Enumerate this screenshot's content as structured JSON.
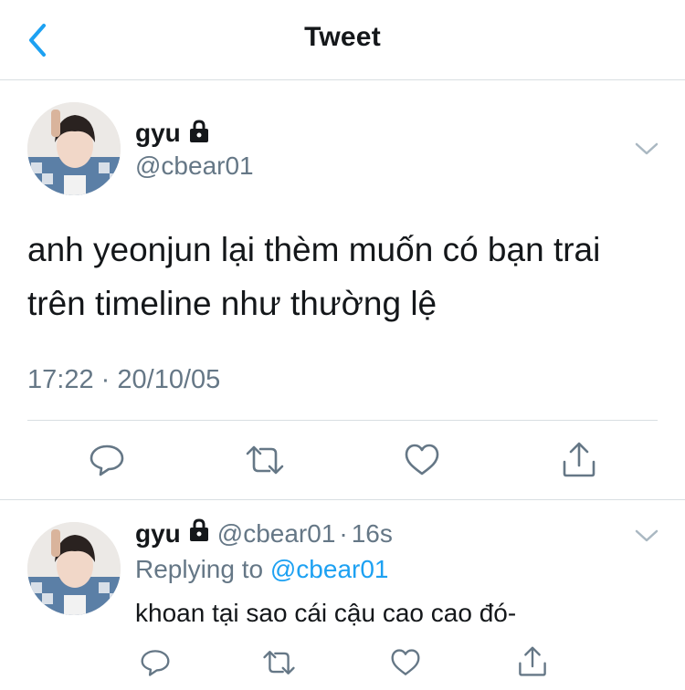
{
  "header": {
    "title": "Tweet",
    "back_icon": "chevron-left-icon",
    "accent_color": "#1da1f2"
  },
  "main_tweet": {
    "display_name": "gyu",
    "handle": "@cbear01",
    "protected_icon": "lock-icon",
    "text_line_1": "anh yeonjun lại thèm muốn có bạn trai",
    "text_line_2": "trên timeline như thường lệ",
    "time": "17:22",
    "separator": "·",
    "date": "20/10/05",
    "actions": [
      "reply-icon",
      "retweet-icon",
      "like-icon",
      "share-icon"
    ]
  },
  "reply_tweet": {
    "display_name": "gyu",
    "handle": "@cbear01",
    "separator": "·",
    "age": "16s",
    "replying_to_label": "Replying to",
    "replying_to_handle": "@cbear01",
    "text": "khoan tại sao cái cậu cao cao đó-",
    "actions": [
      "reply-icon",
      "retweet-icon",
      "like-icon",
      "share-icon"
    ]
  },
  "colors": {
    "text_primary": "#14171a",
    "text_secondary": "#657786",
    "divider": "#d9dee2",
    "icon_gray": "#657786"
  }
}
